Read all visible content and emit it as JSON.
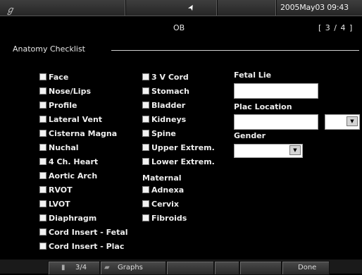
{
  "topbar": {
    "logo_glyph": "ℊ",
    "cursor_glyph": "➤",
    "datetime": "2005May03  09:43"
  },
  "header": {
    "mode": "OB",
    "page_indicator": "[ 3 / 4 ]"
  },
  "section_title": "Anatomy Checklist",
  "checklist": {
    "col1": [
      "Face",
      "Nose/Lips",
      "Profile",
      "Lateral Vent",
      "Cisterna Magna",
      "Nuchal",
      "4 Ch. Heart",
      "Aortic Arch",
      "RVOT",
      "LVOT",
      "Diaphragm",
      "Cord Insert - Fetal",
      "Cord Insert - Plac"
    ],
    "col2": [
      "3 V Cord",
      "Stomach",
      "Bladder",
      "Kidneys",
      "Spine",
      "Upper Extrem.",
      "Lower Extrem."
    ],
    "maternal_heading": "Maternal",
    "maternal": [
      "Adnexa",
      "Cervix",
      "Fibroids"
    ]
  },
  "fields": {
    "fetal_lie_label": "Fetal Lie",
    "fetal_lie_value": "",
    "plac_location_label": "Plac Location",
    "plac_location_value": "",
    "plac_location_select": "",
    "gender_label": "Gender",
    "gender_value": ""
  },
  "icons": {
    "dropdown": "▼",
    "page_icon": "▮",
    "graph_icon": "▰"
  },
  "bottom": {
    "page_label": "3/4",
    "graphs_label": "Graphs",
    "done_label": "Done"
  },
  "colors": {
    "background": "#000000",
    "text": "#eeeeee",
    "field": "#ffffff",
    "button": "#3a3a3a"
  }
}
